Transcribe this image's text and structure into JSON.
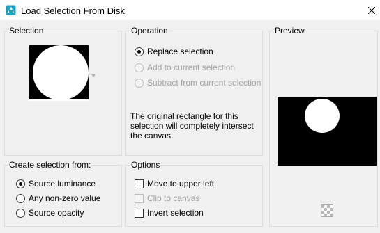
{
  "window": {
    "title": "Load Selection From Disk",
    "close_icon": "close-icon",
    "app_icon": "selection-app-icon"
  },
  "selection": {
    "label": "Selection",
    "thumbnail": "white-circle-on-black"
  },
  "operation": {
    "label": "Operation",
    "options": [
      {
        "label": "Replace selection",
        "checked": true,
        "enabled": true
      },
      {
        "label": "Add to current selection",
        "checked": false,
        "enabled": false
      },
      {
        "label": "Subtract from current selection",
        "checked": false,
        "enabled": false
      }
    ],
    "note_lines": [
      "The original rectangle for this",
      "selection will completely intersect",
      "the canvas."
    ]
  },
  "preview": {
    "label": "Preview",
    "toggle_icon": "checkerboard-icon"
  },
  "create_from": {
    "label": "Create selection from:",
    "options": [
      {
        "label": "Source luminance",
        "checked": true
      },
      {
        "label": "Any non-zero value",
        "checked": false
      },
      {
        "label": "Source opacity",
        "checked": false
      }
    ]
  },
  "options": {
    "label": "Options",
    "items": [
      {
        "label": "Move to upper left",
        "checked": false,
        "enabled": true
      },
      {
        "label": "Clip to canvas",
        "checked": false,
        "enabled": false
      },
      {
        "label": "Invert selection",
        "checked": false,
        "enabled": true
      }
    ]
  },
  "colors": {
    "window_bg": "#f0f0f0",
    "title_bg": "#ffffff",
    "group_border": "#dcdcdc",
    "disabled_text": "#a0a0a0"
  }
}
